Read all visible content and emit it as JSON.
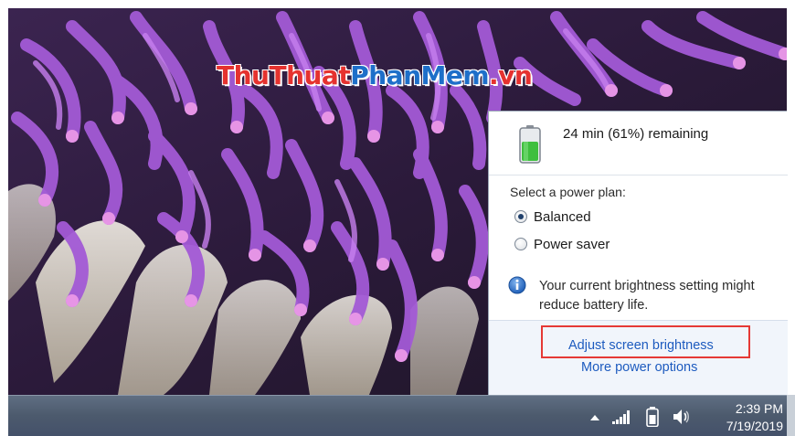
{
  "watermark": {
    "part1": "ThuThuat",
    "part2": "PhanMem",
    "part3": ".vn"
  },
  "power_flyout": {
    "battery_status": "24 min (61%) remaining",
    "battery_level_fraction": 0.61,
    "plan_title": "Select a power plan:",
    "plans": [
      {
        "label": "Balanced",
        "selected": true
      },
      {
        "label": "Power saver",
        "selected": false
      }
    ],
    "warning_text": "Your current brightness setting might reduce battery life.",
    "adjust_brightness_link": "Adjust screen brightness",
    "more_power_options_link": "More power options",
    "highlight_color": "#e53935",
    "link_color": "#1d5bbf"
  },
  "taskbar": {
    "icons": [
      "show-hidden-icons-arrow",
      "network-signal-icon",
      "battery-icon",
      "volume-icon"
    ],
    "clock_time": "2:39 PM",
    "clock_date": "7/19/2019"
  }
}
